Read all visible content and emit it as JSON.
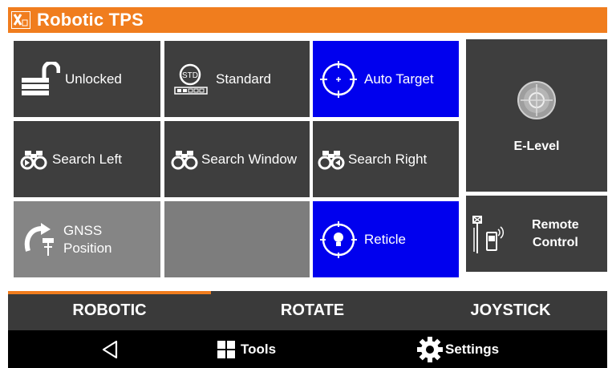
{
  "app": {
    "title": "Robotic TPS"
  },
  "tiles": {
    "unlocked": "Unlocked",
    "standard": "Standard",
    "standard_badge": "STD",
    "auto_target": "Auto Target",
    "search_left": "Search Left",
    "search_window": "Search Window",
    "search_right": "Search Right",
    "gnss_line1": "GNSS",
    "gnss_line2": "Position",
    "reticle": "Reticle",
    "e_level": "E-Level",
    "remote_line1": "Remote",
    "remote_line2": "Control"
  },
  "tabs": [
    {
      "label": "ROBOTIC",
      "active": true
    },
    {
      "label": "ROTATE",
      "active": false
    },
    {
      "label": "JOYSTICK",
      "active": false
    }
  ],
  "nav": {
    "tools": "Tools",
    "settings": "Settings"
  },
  "colors": {
    "accent": "#f07d1e",
    "active_tile": "#0000ee",
    "tile": "#3e3e3e",
    "disabled_tile": "#858585"
  }
}
